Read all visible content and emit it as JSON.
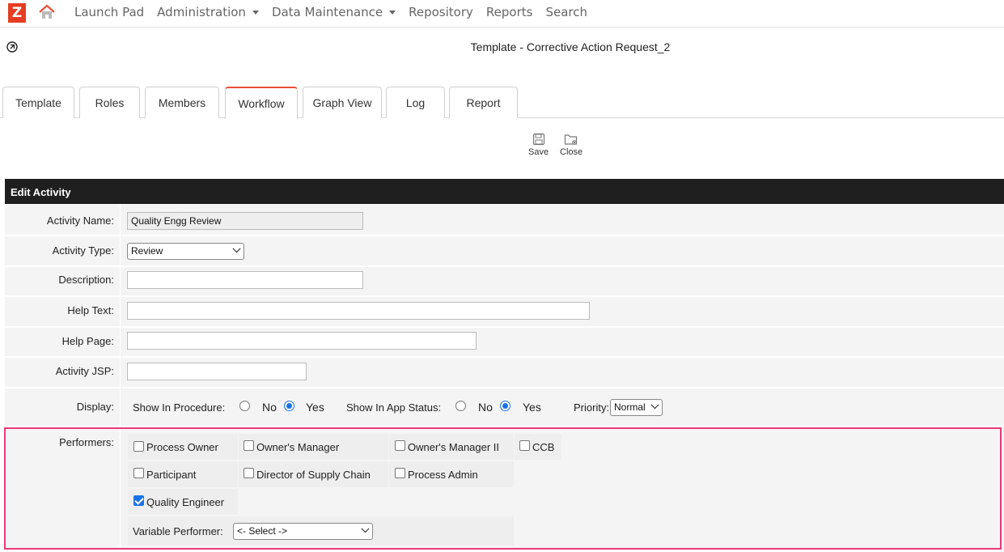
{
  "nav": {
    "logo_letter": "Z",
    "items": [
      {
        "label": "Launch Pad",
        "dropdown": false
      },
      {
        "label": "Administration",
        "dropdown": true
      },
      {
        "label": "Data Maintenance",
        "dropdown": true
      },
      {
        "label": "Repository",
        "dropdown": false
      },
      {
        "label": "Reports",
        "dropdown": false
      },
      {
        "label": "Search",
        "dropdown": false
      }
    ]
  },
  "page_title": "Template - Corrective Action Request_2",
  "tabs": [
    {
      "label": "Template",
      "active": false
    },
    {
      "label": "Roles",
      "active": false
    },
    {
      "label": "Members",
      "active": false
    },
    {
      "label": "Workflow",
      "active": true
    },
    {
      "label": "Graph View",
      "active": false
    },
    {
      "label": "Log",
      "active": false
    },
    {
      "label": "Report",
      "active": false
    }
  ],
  "toolbar": {
    "save_label": "Save",
    "close_label": "Close"
  },
  "panel": {
    "header": "Edit Activity",
    "activity_name_label": "Activity Name:",
    "activity_name_value": "Quality Engg Review",
    "activity_type_label": "Activity Type:",
    "activity_type_value": "Review",
    "description_label": "Description:",
    "description_value": "",
    "help_text_label": "Help Text:",
    "help_text_value": "",
    "help_page_label": "Help Page:",
    "help_page_value": "",
    "activity_jsp_label": "Activity JSP:",
    "activity_jsp_value": "",
    "display_label": "Display:",
    "show_in_procedure_label": "Show In Procedure:",
    "show_in_app_status_label": "Show In App Status:",
    "no_label": "No",
    "yes_label": "Yes",
    "show_in_procedure_value": "Yes",
    "show_in_app_status_value": "Yes",
    "priority_label": "Priority:",
    "priority_value": "Normal",
    "performers_label": "Performers:",
    "performers": [
      {
        "label": "Process Owner",
        "checked": false
      },
      {
        "label": "Owner's Manager",
        "checked": false
      },
      {
        "label": "Owner's Manager II",
        "checked": false
      },
      {
        "label": "CCB",
        "checked": false
      },
      {
        "label": "Participant",
        "checked": false
      },
      {
        "label": "Director of Supply Chain",
        "checked": false
      },
      {
        "label": "Process Admin",
        "checked": false
      },
      {
        "label": "Quality Engineer",
        "checked": true
      }
    ],
    "variable_performer_label": "Variable Performer:",
    "variable_performer_value": "<- Select ->"
  },
  "colors": {
    "logo": "#e53d22",
    "active_tab": "#e8503a",
    "header_bg": "#1f1f1f",
    "highlight": "#e83a7a",
    "checkbox_on": "#1a73e8"
  }
}
